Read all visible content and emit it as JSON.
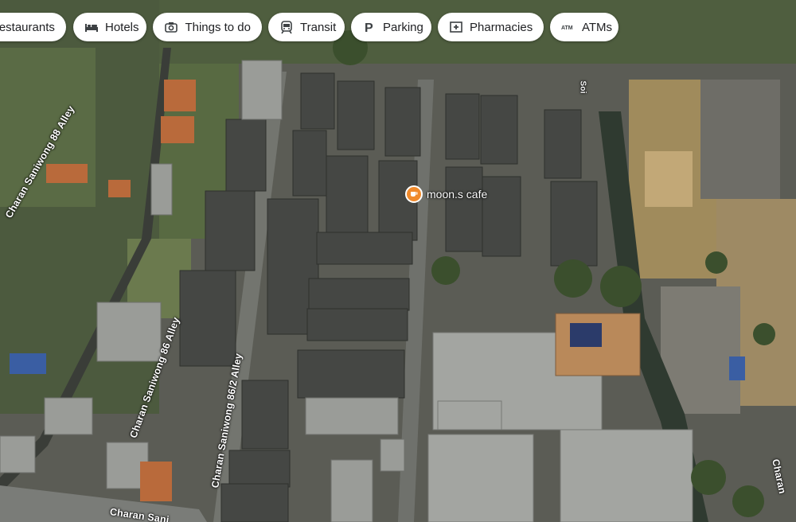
{
  "filter_chips": [
    {
      "label": "Restaurants",
      "icon": "restaurant-icon"
    },
    {
      "label": "Hotels",
      "icon": "bed-icon"
    },
    {
      "label": "Things to do",
      "icon": "camera-icon"
    },
    {
      "label": "Transit",
      "icon": "train-icon"
    },
    {
      "label": "Parking",
      "icon": "parking-icon"
    },
    {
      "label": "Pharmacies",
      "icon": "pharmacy-icon"
    },
    {
      "label": "ATMs",
      "icon": "atm-icon"
    }
  ],
  "place": {
    "name": "moon.s cafe",
    "icon": "cafe-icon",
    "color": "#f08a2b"
  },
  "roads": [
    "Charan Saniwong 88 Alley",
    "Charan Saniwong 86 Alley",
    "Charan Saniwong 86/2 Alley",
    "Charan Sani",
    "Charan",
    "Soi"
  ]
}
